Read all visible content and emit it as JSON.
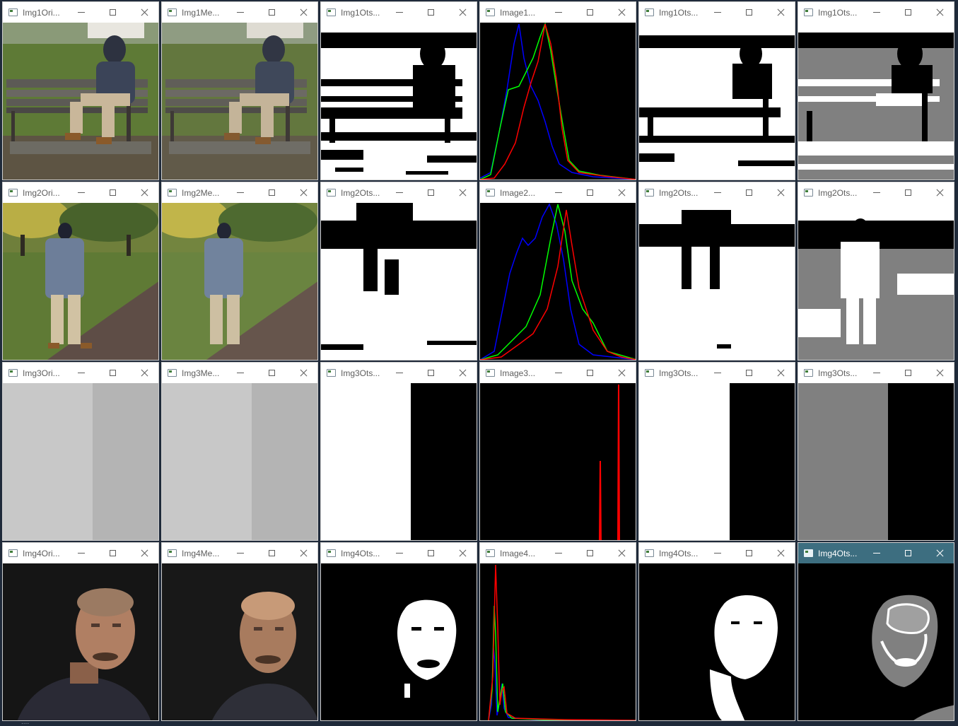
{
  "windows": [
    {
      "title": "Img1Ori..."
    },
    {
      "title": "Img1Me..."
    },
    {
      "title": "Img1Ots..."
    },
    {
      "title": "Image1..."
    },
    {
      "title": "Img1Ots..."
    },
    {
      "title": "Img1Ots..."
    },
    {
      "title": "Img2Ori..."
    },
    {
      "title": "Img2Me..."
    },
    {
      "title": "Img2Ots..."
    },
    {
      "title": "Image2..."
    },
    {
      "title": "Img2Ots..."
    },
    {
      "title": "Img2Ots..."
    },
    {
      "title": "Img3Ori..."
    },
    {
      "title": "Img3Me..."
    },
    {
      "title": "Img3Ots..."
    },
    {
      "title": "Image3..."
    },
    {
      "title": "Img3Ots..."
    },
    {
      "title": "Img3Ots..."
    },
    {
      "title": "Img4Ori..."
    },
    {
      "title": "Img4Me..."
    },
    {
      "title": "Img4Ots..."
    },
    {
      "title": "Image4..."
    },
    {
      "title": "Img4Ots..."
    },
    {
      "title": "Img4Ots..."
    }
  ],
  "active_window_index": 23,
  "icons": {
    "app": "app-window-icon",
    "minimize": "minimize-icon",
    "maximize": "maximize-icon",
    "close": "close-icon"
  },
  "colors": {
    "active_titlebar": "#3d6e80",
    "histogram_red": "#ff0000",
    "histogram_green": "#00ff00",
    "histogram_blue": "#0000ff"
  },
  "taskbar_ghost_text": "...."
}
